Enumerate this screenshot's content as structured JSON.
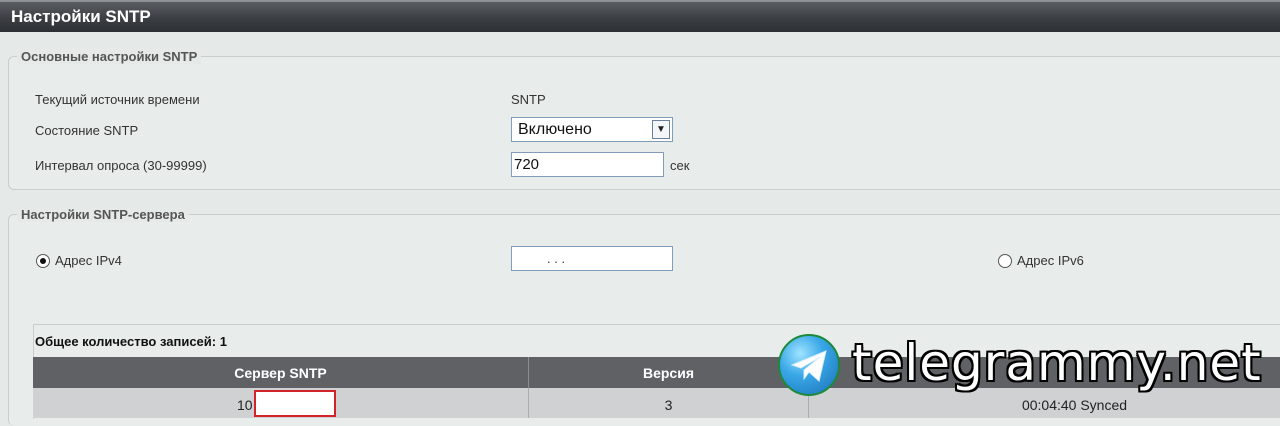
{
  "window": {
    "title": "Настройки SNTP"
  },
  "basic": {
    "legend": "Основные настройки SNTP",
    "time_source_label": "Текущий источник времени",
    "time_source_value": "SNTP",
    "state_label": "Состояние SNTP",
    "state_value": "Включено",
    "interval_label": "Интервал опроса (30-99999)",
    "interval_value": "720",
    "interval_unit": "сек"
  },
  "server": {
    "legend": "Настройки SNTP-сервера",
    "ipv4_label": "Адрес IPv4",
    "ipv4_value": ".       .       .",
    "ipv4_selected": true,
    "ipv6_label": "Адрес IPv6",
    "ipv6_selected": false
  },
  "table": {
    "total_label": "Общее количество записей: 1",
    "headers": [
      "Сервер SNTP",
      "Версия",
      ""
    ],
    "rows": [
      {
        "server": "10",
        "version": "3",
        "status": "00:04:40 Synced"
      }
    ]
  },
  "watermark": {
    "text": "telegrammy.net",
    "icon": "telegram-logo-icon"
  }
}
